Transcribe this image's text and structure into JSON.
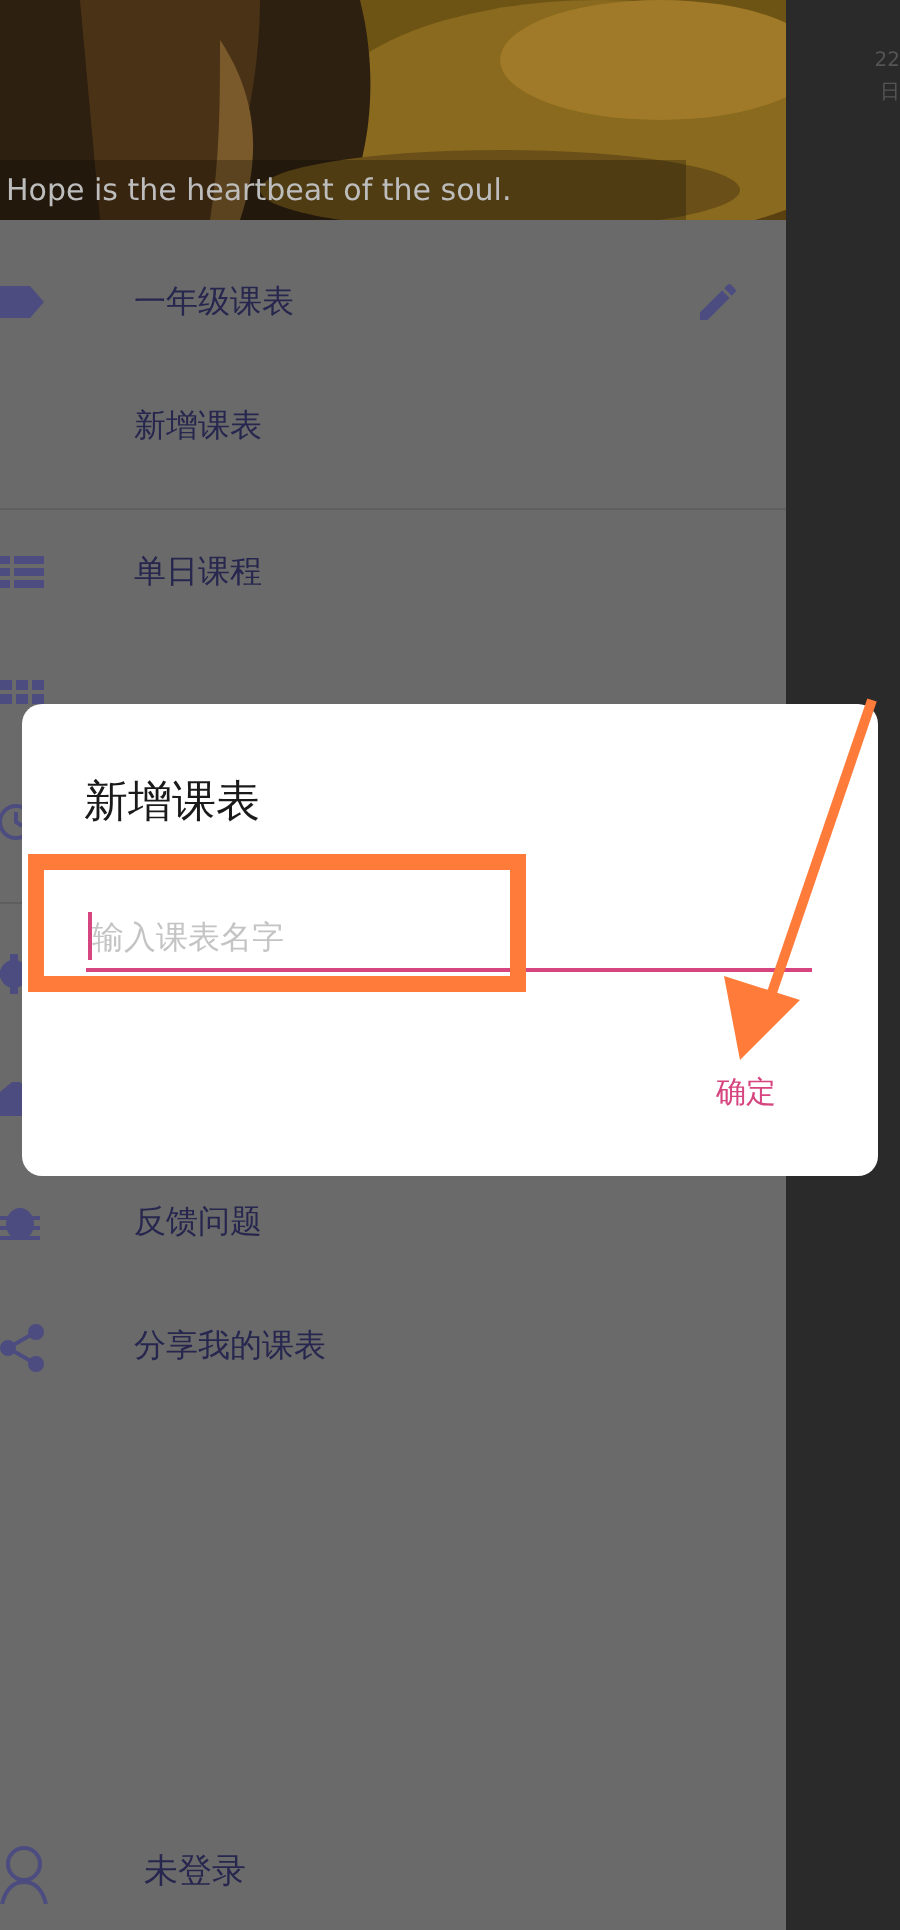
{
  "header": {
    "kind": "picture",
    "quote": "Hope is the heartbeat of the soul."
  },
  "schedules": [
    {
      "kind": "tag",
      "label": "一年级课表",
      "editable": true
    },
    {
      "kind": "plain",
      "label": "新增课表",
      "editable": false
    }
  ],
  "menu_groups": [
    [
      {
        "kind": "list",
        "label": "单日课程"
      },
      {
        "kind": "grid"
      },
      {
        "kind": "clock"
      }
    ],
    [
      {
        "kind": "gear"
      },
      {
        "kind": "shirt"
      },
      {
        "kind": "bug",
        "label": "反馈问题"
      },
      {
        "kind": "share",
        "label": "分享我的课表"
      }
    ]
  ],
  "account": {
    "label": "未登录"
  },
  "behind": {
    "texts": [
      "22",
      "日"
    ]
  },
  "dialog": {
    "title": "新增课表",
    "input": {
      "placeholder": "输入课表名字",
      "focused": true
    },
    "confirm": "确定"
  }
}
